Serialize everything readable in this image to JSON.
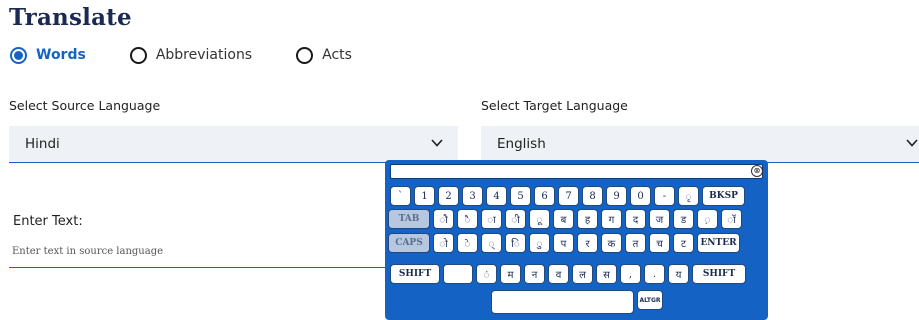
{
  "page": {
    "title": "Translate"
  },
  "modes": [
    {
      "label": "Words",
      "selected": true
    },
    {
      "label": "Abbreviations",
      "selected": false
    },
    {
      "label": "Acts",
      "selected": false
    }
  ],
  "source": {
    "label": "Select Source Language",
    "value": "Hindi"
  },
  "target": {
    "label": "Select Target Language",
    "value": "English"
  },
  "input": {
    "label": "Enter Text:",
    "placeholder": "Enter text in source language"
  },
  "keyboard": {
    "close_symbol": "⊗",
    "row1": [
      "`",
      "1",
      "2",
      "3",
      "4",
      "5",
      "6",
      "7",
      "8",
      "9",
      "0",
      "-",
      "ृ",
      "BKSP"
    ],
    "row2": [
      "TAB",
      "ौ",
      "ै",
      "ा",
      "ी",
      "ू",
      "ब",
      "ह",
      "ग",
      "द",
      "ज",
      "ड",
      "़",
      "ॉ"
    ],
    "row3": [
      "CAPS",
      "ो",
      "े",
      "्",
      "ि",
      "ु",
      "प",
      "र",
      "क",
      "त",
      "च",
      "ट",
      "ENTER"
    ],
    "row4": [
      "SHIFT",
      "",
      "ं",
      "म",
      "न",
      "व",
      "ल",
      "स",
      ",",
      ".",
      "य",
      "SHIFT"
    ],
    "row5": [
      "",
      "ALTGR"
    ]
  }
}
